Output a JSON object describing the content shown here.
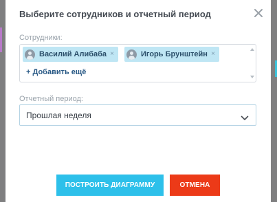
{
  "dialog": {
    "title": "Выберите сотрудников и отчетный период",
    "employees_label": "Сотрудники:",
    "employees": [
      {
        "name": "Василий Алибаба"
      },
      {
        "name": "Игорь Брунштейн"
      }
    ],
    "tag_remove_glyph": "×",
    "add_more_label": "+ Добавить ещё",
    "period_label": "Отчетный период:",
    "period_value": "Прошлая неделя",
    "submit_label": "ПОСТРОИТЬ ДИАГРАММУ",
    "cancel_label": "ОТМЕНА"
  },
  "icons": {
    "close": "close-icon",
    "avatar": "user-avatar-icon",
    "dropdown": "chevron-down-icon"
  },
  "colors": {
    "primary": "#2dc0ea",
    "danger": "#ec3a18",
    "tag_bg": "#bfe6f4",
    "overlay": "#7f7f80"
  }
}
